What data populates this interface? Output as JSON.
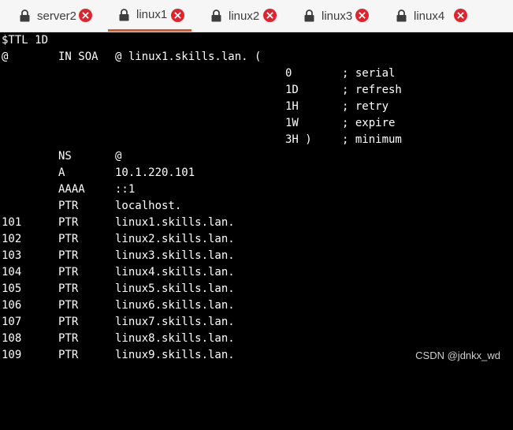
{
  "tabs": [
    {
      "label": "server2",
      "active": false
    },
    {
      "label": "linux1",
      "active": true
    },
    {
      "label": "linux2",
      "active": false
    },
    {
      "label": "linux3",
      "active": false
    },
    {
      "label": "linux4",
      "active": false
    }
  ],
  "zone": {
    "ttl_line": "$TTL 1D",
    "soa_at": "@",
    "soa_type": "IN SOA",
    "soa_data": "@ linux1.skills.lan. (",
    "soa_fields": [
      {
        "value": "0",
        "comment": "; serial"
      },
      {
        "value": "1D",
        "comment": "; refresh"
      },
      {
        "value": "1H",
        "comment": "; retry"
      },
      {
        "value": "1W",
        "comment": "; expire"
      },
      {
        "value": "3H )",
        "comment": "; minimum"
      }
    ],
    "records": [
      {
        "name": "",
        "type": "NS",
        "data": "@"
      },
      {
        "name": "",
        "type": "A",
        "data": "10.1.220.101"
      },
      {
        "name": "",
        "type": "AAAA",
        "data": "::1"
      },
      {
        "name": "",
        "type": "PTR",
        "data": "localhost."
      },
      {
        "name": "101",
        "type": "PTR",
        "data": "linux1.skills.lan."
      },
      {
        "name": "102",
        "type": "PTR",
        "data": "linux2.skills.lan."
      },
      {
        "name": "103",
        "type": "PTR",
        "data": "linux3.skills.lan."
      },
      {
        "name": "104",
        "type": "PTR",
        "data": "linux4.skills.lan."
      },
      {
        "name": "105",
        "type": "PTR",
        "data": "linux5.skills.lan."
      },
      {
        "name": "106",
        "type": "PTR",
        "data": "linux6.skills.lan."
      },
      {
        "name": "107",
        "type": "PTR",
        "data": "linux7.skills.lan."
      },
      {
        "name": "108",
        "type": "PTR",
        "data": "linux8.skills.lan."
      },
      {
        "name": "109",
        "type": "PTR",
        "data": "linux9.skills.lan."
      }
    ]
  },
  "watermark": "CSDN @jdnkx_wd",
  "colors": {
    "accent": "#e95420",
    "close": "#e0232c",
    "terminal_bg": "#000000",
    "terminal_fg": "#ffffff"
  },
  "icons": {
    "tab": "lock-icon",
    "close": "close-icon"
  }
}
